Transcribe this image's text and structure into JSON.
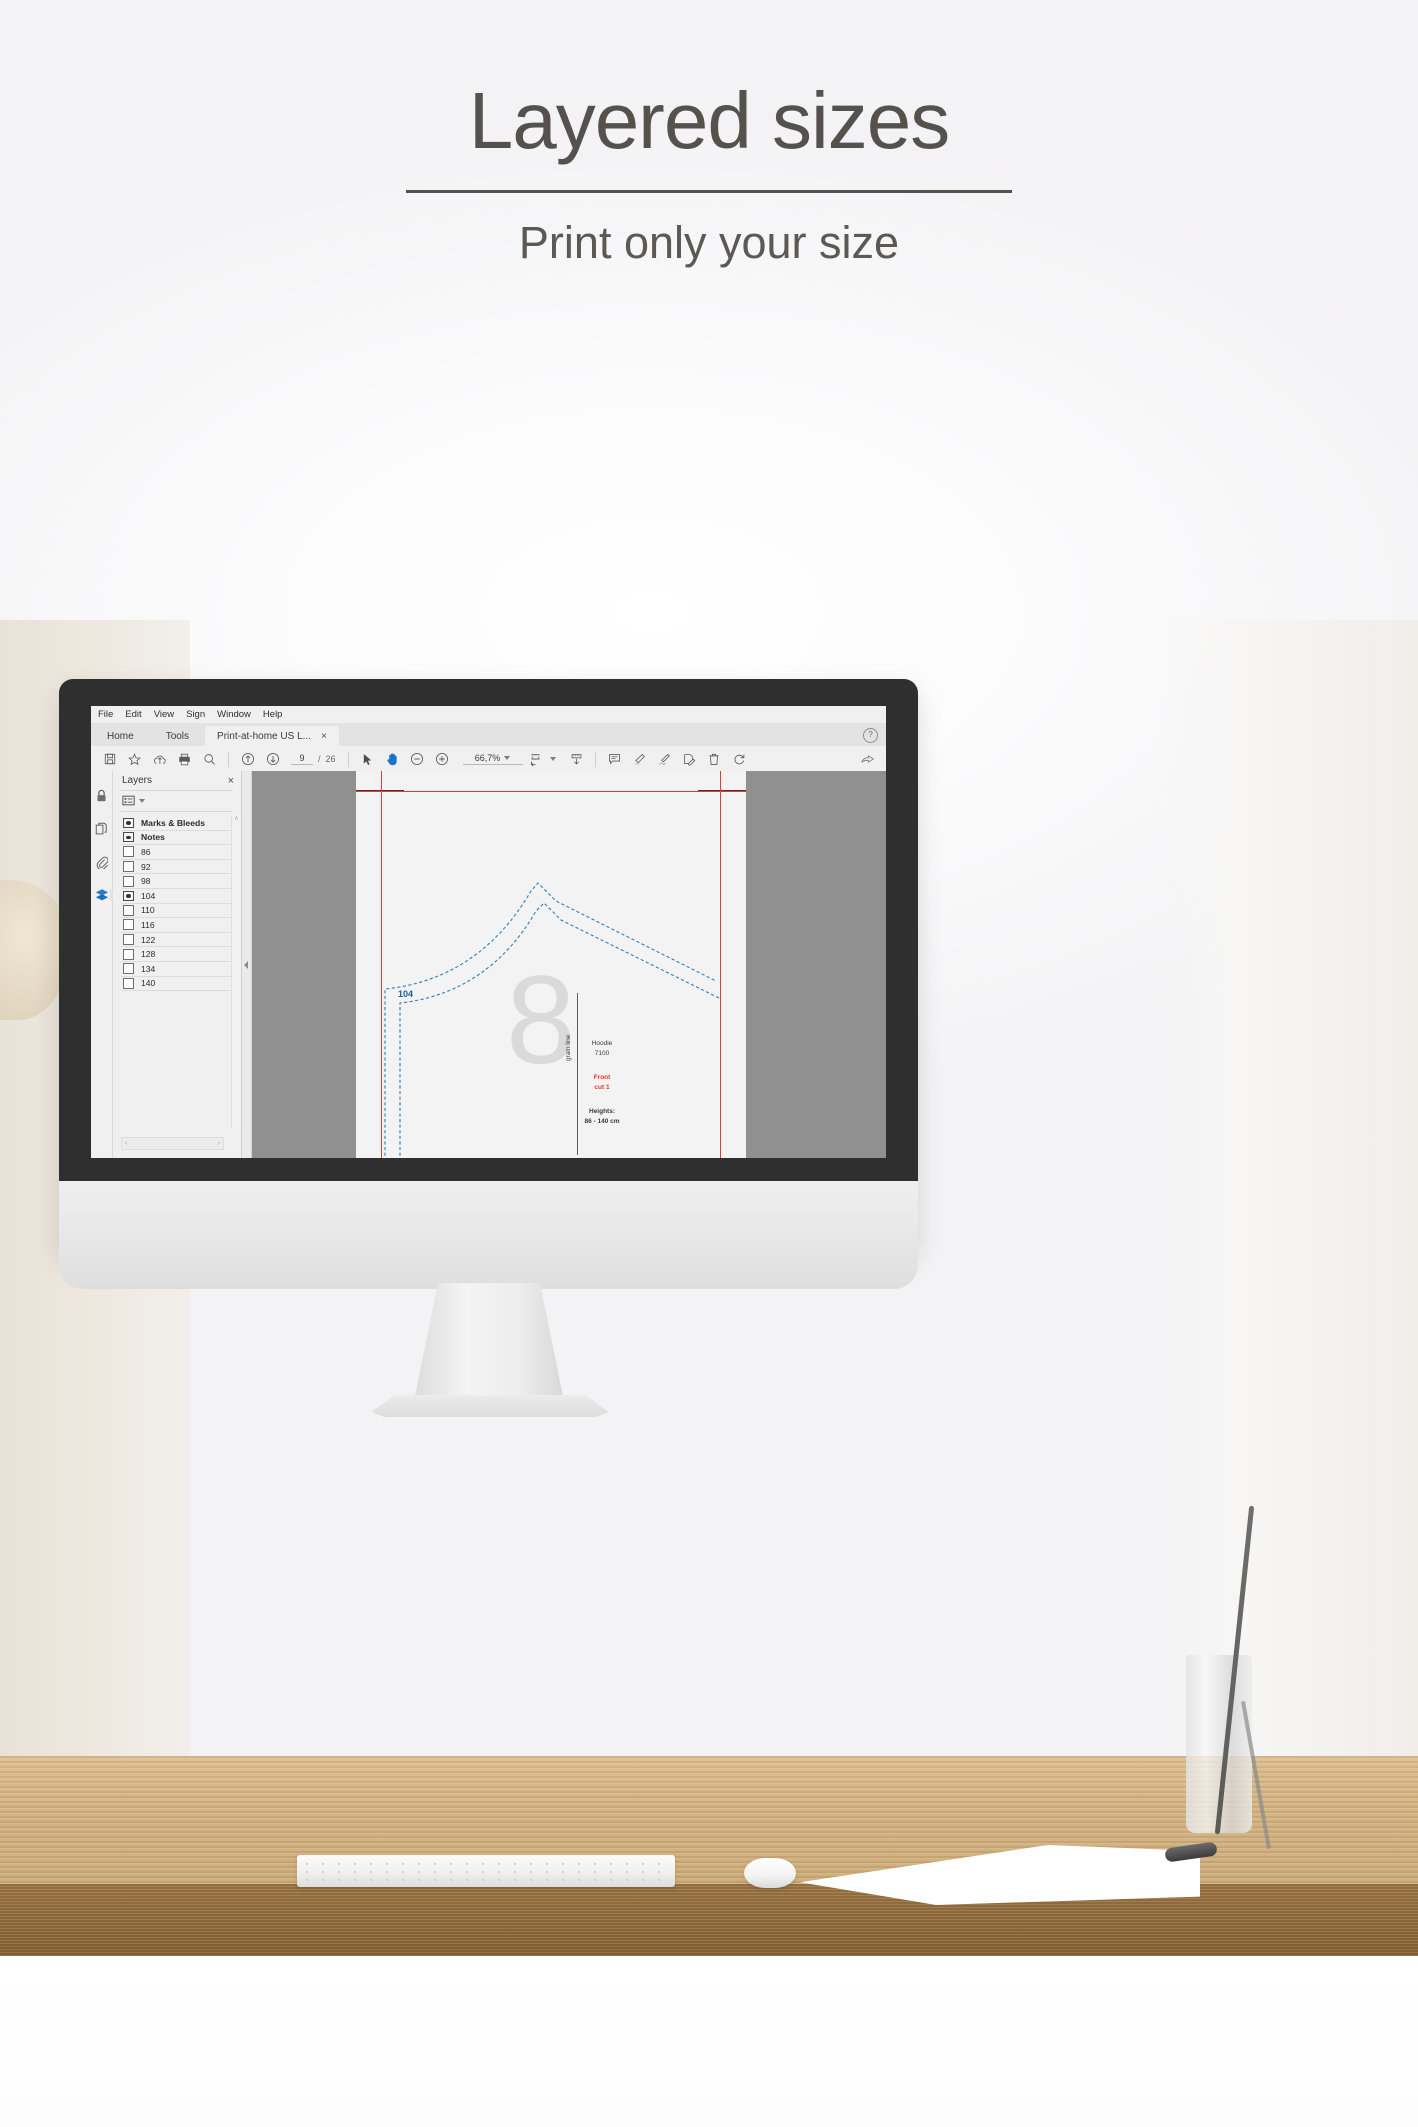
{
  "poster": {
    "title": "Layered sizes",
    "subtitle": "Print only your size"
  },
  "app": {
    "menubar": [
      "File",
      "Edit",
      "View",
      "Sign",
      "Window",
      "Help"
    ],
    "tabs": [
      {
        "label": "Home",
        "type": "plain"
      },
      {
        "label": "Tools",
        "type": "plain"
      },
      {
        "label": "Print-at-home US L...",
        "type": "active",
        "close": "×"
      }
    ],
    "help_label": "?",
    "toolbar": {
      "page_current": "9",
      "page_separator": "/",
      "page_total": "26",
      "zoom_value": "66,7%",
      "icons_left": [
        "save-icon",
        "star-icon",
        "cloud-upload-icon",
        "print-icon",
        "search-icon"
      ],
      "icons_nav": [
        "previous-page-icon",
        "next-page-icon"
      ],
      "icons_tools": [
        "select-tool-icon",
        "hand-tool-icon",
        "zoom-out-icon",
        "zoom-in-icon"
      ],
      "icons_view": [
        "fit-page-icon",
        "scroll-mode-icon"
      ],
      "icons_annot": [
        "comment-icon",
        "highlight-icon",
        "sign-icon",
        "stamp-icon",
        "delete-icon",
        "rotate-icon"
      ],
      "icon_share": "share-icon"
    }
  },
  "panel": {
    "title": "Layers",
    "close_label": "×",
    "options_icon": "list-options-icon",
    "layers": [
      {
        "name": "Marks & Bleeds",
        "visible": true,
        "bold": true
      },
      {
        "name": "Notes",
        "visible": true,
        "bold": true
      },
      {
        "name": "86",
        "visible": false,
        "bold": false
      },
      {
        "name": "92",
        "visible": false,
        "bold": false
      },
      {
        "name": "98",
        "visible": false,
        "bold": false
      },
      {
        "name": "104",
        "visible": true,
        "bold": false
      },
      {
        "name": "110",
        "visible": false,
        "bold": false
      },
      {
        "name": "116",
        "visible": false,
        "bold": false
      },
      {
        "name": "122",
        "visible": false,
        "bold": false
      },
      {
        "name": "128",
        "visible": false,
        "bold": false
      },
      {
        "name": "134",
        "visible": false,
        "bold": false
      },
      {
        "name": "140",
        "visible": false,
        "bold": false
      }
    ],
    "hscroll_left": "‹",
    "hscroll_right": "›",
    "vscroll_up": "˄",
    "vscroll_down": "˅"
  },
  "document": {
    "size_label": "104",
    "piece_number": "8",
    "grain_label": "grain line",
    "garment_name": "Hoodie",
    "pattern_number": "7100",
    "piece_name": "Front",
    "cut_instruction": "cut 1",
    "heights_label": "Heights:",
    "heights_value": "86 - 140 cm"
  },
  "colors": {
    "title_text": "#55524e",
    "accent_blue": "#1c5c9e",
    "pattern_dash": "#2e7dbe",
    "margin_red": "#e23b32",
    "note_red": "#e8312a",
    "bezel": "#2f2f2f",
    "viewport_gray": "#909090",
    "desk_wood": "#ceac79"
  }
}
